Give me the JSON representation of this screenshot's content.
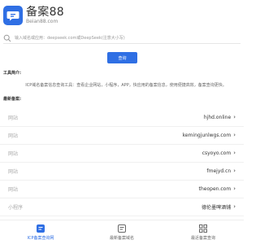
{
  "header": {
    "logo_title": "备案88",
    "logo_subtitle": "Beian88.com"
  },
  "search": {
    "placeholder": "输入域名或应用：deepseek.com或DeepSeek(注意大小写)"
  },
  "query_button": "查询",
  "tools": {
    "label": "工具简介:",
    "description": "ICP域名备案信息查询工具：查看企业网站，小程序，APP，快应用的备案信息，使用便捷高效，备案查询更快。"
  },
  "recent": {
    "label": "最新备案:",
    "items": [
      {
        "type": "网站",
        "value": "hjhd.online"
      },
      {
        "type": "网站",
        "value": "kemingjunlwgs.com"
      },
      {
        "type": "网站",
        "value": "csyoyo.com"
      },
      {
        "type": "网站",
        "value": "fmejyd.cn"
      },
      {
        "type": "网站",
        "value": "theopen.com"
      },
      {
        "type": "小程序",
        "value": "德伦墨啤酒铺"
      }
    ]
  },
  "bottom_nav": [
    {
      "label": "ICP备案查询网",
      "active": true
    },
    {
      "label": "最新备案域名",
      "active": false
    },
    {
      "label": "最近备案查询",
      "active": false
    }
  ],
  "colors": {
    "accent": "#2f6fe4"
  }
}
